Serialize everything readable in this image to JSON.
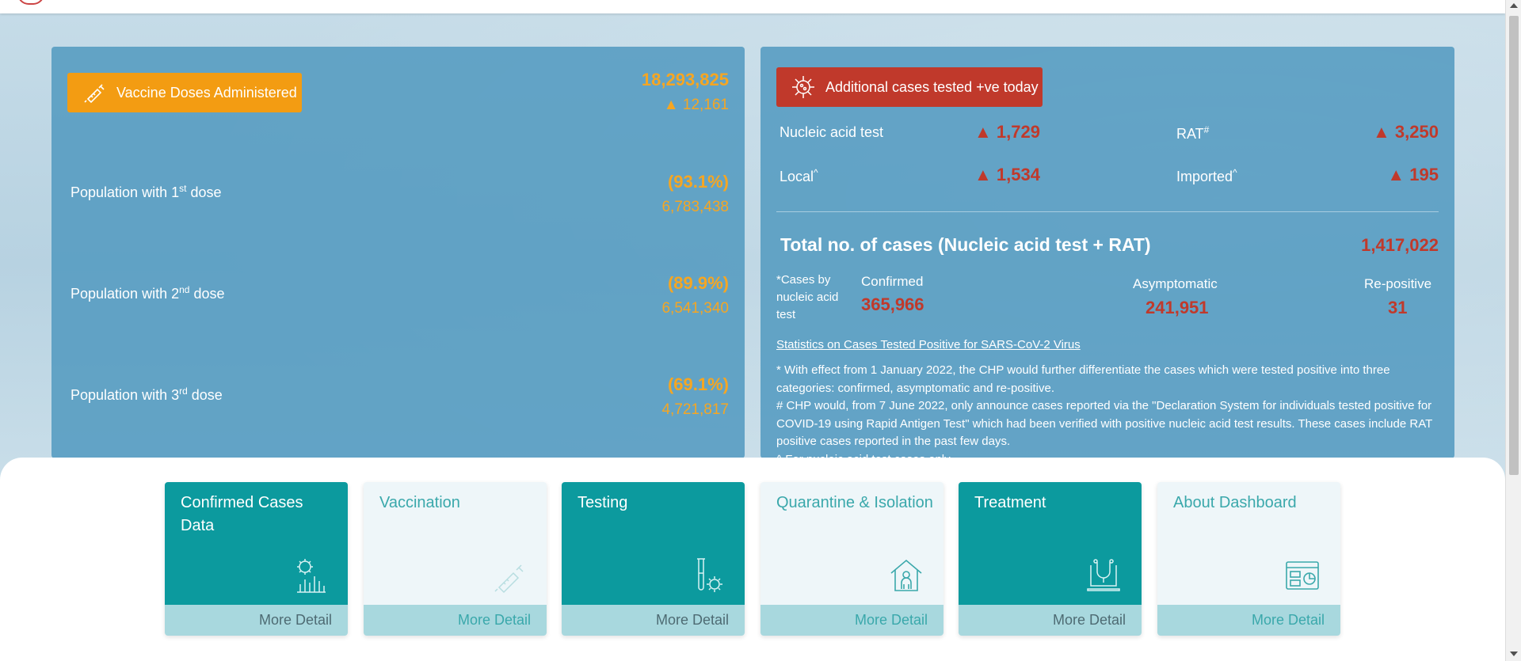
{
  "left_panel": {
    "vaccine_button_label": "Vaccine Doses Administered",
    "doses_total": "18,293,825",
    "doses_change": "▲ 12,161",
    "rows": [
      {
        "label_pre": "Population with 1",
        "sup": "st",
        "label_post": " dose",
        "percent": "(93.1%)",
        "count": "6,783,438"
      },
      {
        "label_pre": "Population with 2",
        "sup": "nd",
        "label_post": " dose",
        "percent": "(89.9%)",
        "count": "6,541,340"
      },
      {
        "label_pre": "Population with 3",
        "sup": "rd",
        "label_post": " dose",
        "percent": "(69.1%)",
        "count": "4,721,817"
      }
    ]
  },
  "right_panel": {
    "additional_button_label": "Additional cases tested +ve today",
    "nucleic_label": "Nucleic acid test",
    "nucleic_value": "▲ 1,729",
    "rat_label": "RAT",
    "rat_sup": "#",
    "rat_value": "▲ 3,250",
    "local_label": "Local",
    "local_sup": "^",
    "local_value": "▲ 1,534",
    "imported_label": "Imported",
    "imported_sup": "^",
    "imported_value": "▲ 195",
    "total_label": "Total no. of cases (Nucleic acid test + RAT)",
    "total_value": "1,417,022",
    "cases_by_label": "*Cases by nucleic acid test",
    "confirmed_label": "Confirmed",
    "confirmed_value": "365,966",
    "asymptomatic_label": "Asymptomatic",
    "asymptomatic_value": "241,951",
    "repositive_label": "Re-positive",
    "repositive_value": "31",
    "stats_link": "Statistics on Cases Tested Positive for SARS-CoV-2 Virus",
    "note_1": "* With effect from 1 January 2022, the CHP would further differentiate the cases which were tested positive into three categories: confirmed, asymptomatic and re-positive.",
    "note_2": "# CHP would, from 7 June 2022, only announce cases reported via the \"Declaration System for individuals tested positive for COVID-19 using Rapid Antigen Test\" which had been verified with positive nucleic acid test results. These cases include RAT positive cases reported in the past few days.",
    "note_3": "^ For nucleic acid test cases only"
  },
  "cards": [
    {
      "title": "Confirmed Cases Data",
      "more": "More Detail",
      "style": "dark",
      "icon": "virus-chart-icon"
    },
    {
      "title": "Vaccination",
      "more": "More Detail",
      "style": "light",
      "icon": "syringe-icon"
    },
    {
      "title": "Testing",
      "more": "More Detail",
      "style": "dark",
      "icon": "test-tube-icon"
    },
    {
      "title": "Quarantine & Isolation",
      "more": "More Detail",
      "style": "light",
      "icon": "house-person-icon"
    },
    {
      "title": "Treatment",
      "more": "More Detail",
      "style": "dark",
      "icon": "stethoscope-laptop-icon"
    },
    {
      "title": "About Dashboard",
      "more": "More Detail",
      "style": "light",
      "icon": "dashboard-icon"
    }
  ],
  "colors": {
    "orange": "#f39c12",
    "red": "#c0392b",
    "teal": "#0c9a9e",
    "panel_blue": "#549bc0"
  }
}
